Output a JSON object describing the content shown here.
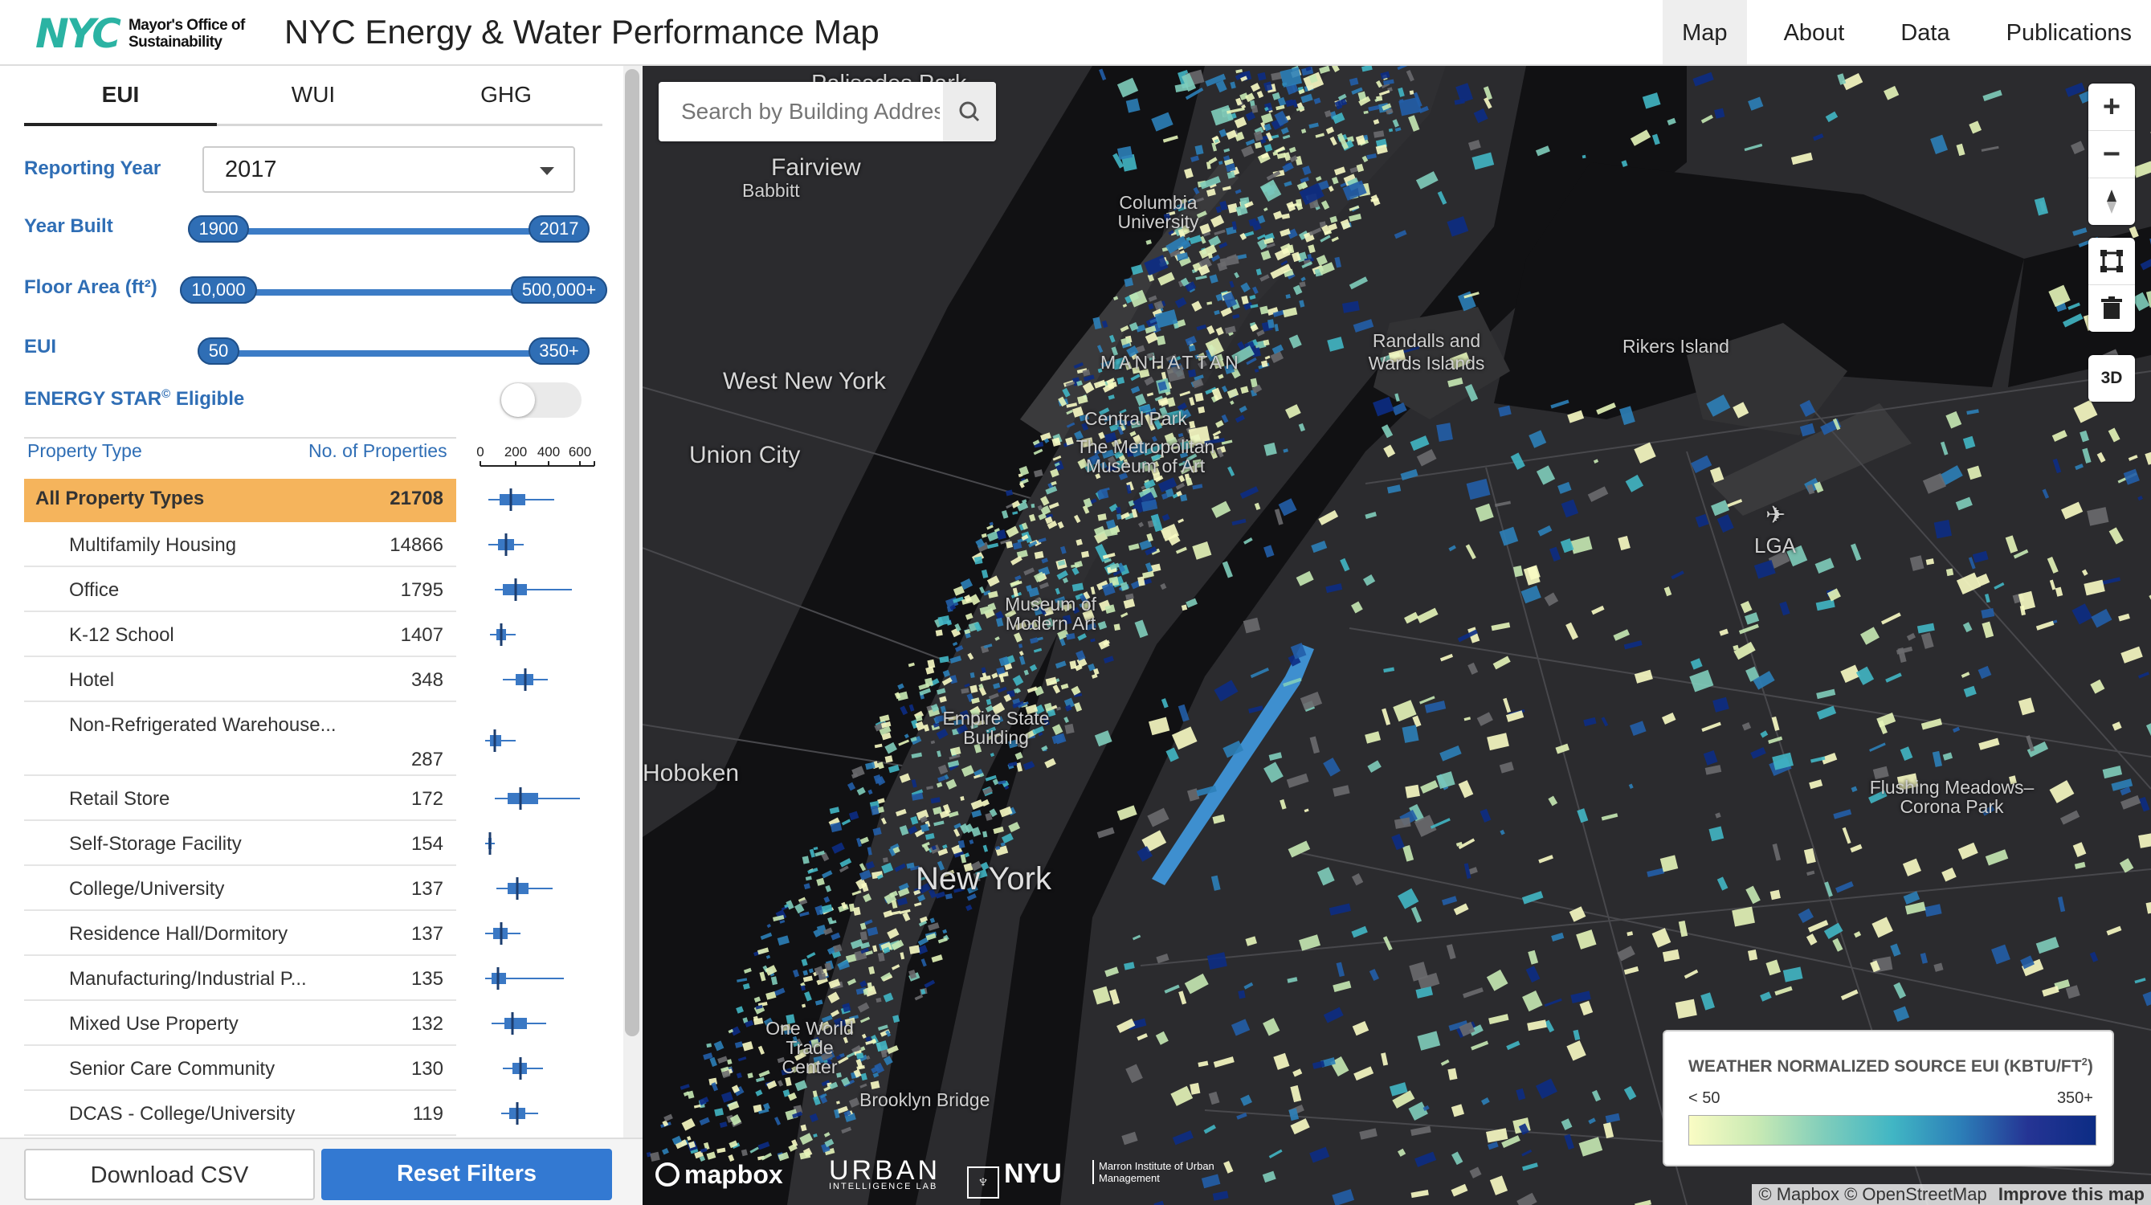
{
  "header": {
    "logo_nyc": "NYC",
    "logo_office_line1": "Mayor's Office of",
    "logo_office_line2": "Sustainability",
    "title": "NYC Energy & Water Performance Map",
    "nav": [
      {
        "label": "Map",
        "active": true
      },
      {
        "label": "About",
        "active": false
      },
      {
        "label": "Data",
        "active": false
      },
      {
        "label": "Publications",
        "active": false
      }
    ]
  },
  "sidebar": {
    "tabs": [
      {
        "label": "EUI",
        "active": true
      },
      {
        "label": "WUI",
        "active": false
      },
      {
        "label": "GHG",
        "active": false
      }
    ],
    "filters": {
      "reporting_year_label": "Reporting Year",
      "reporting_year_value": "2017",
      "year_built_label": "Year Built",
      "year_built_min": "1900",
      "year_built_max": "2017",
      "floor_area_label": "Floor Area (ft²)",
      "floor_area_min": "10,000",
      "floor_area_max": "500,000+",
      "eui_label": "EUI",
      "eui_min": "50",
      "eui_max": "350+",
      "energy_star_label": "ENERGY STAR",
      "energy_star_sup": "©",
      "energy_star_suffix": " Eligible",
      "energy_star_on": false
    },
    "list": {
      "col_type": "Property Type",
      "col_count": "No. of Properties",
      "axis_ticks": [
        "0",
        "200",
        "400",
        "600"
      ],
      "rows": [
        {
          "name": "All Property Types",
          "count": "21708",
          "selected": true,
          "box": [
            10,
            24,
            38,
            56,
            92
          ]
        },
        {
          "name": "Multifamily Housing",
          "count": "14866",
          "selected": false,
          "box": [
            10,
            22,
            32,
            42,
            54
          ]
        },
        {
          "name": "Office",
          "count": "1795",
          "selected": false,
          "box": [
            18,
            28,
            44,
            58,
            114
          ]
        },
        {
          "name": "K-12 School",
          "count": "1407",
          "selected": false,
          "box": [
            12,
            20,
            26,
            32,
            44
          ]
        },
        {
          "name": "Hotel",
          "count": "348",
          "selected": false,
          "box": [
            28,
            44,
            56,
            66,
            84
          ]
        },
        {
          "name": "Non-Refrigerated Warehouse...",
          "count": "287",
          "selected": false,
          "box": [
            6,
            12,
            18,
            26,
            44
          ]
        },
        {
          "name": "Retail Store",
          "count": "172",
          "selected": false,
          "box": [
            18,
            34,
            50,
            72,
            124
          ]
        },
        {
          "name": "Self-Storage Facility",
          "count": "154",
          "selected": false,
          "box": [
            6,
            10,
            12,
            14,
            18
          ]
        },
        {
          "name": "College/University",
          "count": "137",
          "selected": false,
          "box": [
            20,
            34,
            46,
            60,
            90
          ]
        },
        {
          "name": "Residence Hall/Dormitory",
          "count": "137",
          "selected": false,
          "box": [
            6,
            16,
            26,
            34,
            50
          ]
        },
        {
          "name": "Manufacturing/Industrial P...",
          "count": "135",
          "selected": false,
          "box": [
            6,
            14,
            22,
            32,
            104
          ]
        },
        {
          "name": "Mixed Use Property",
          "count": "132",
          "selected": false,
          "box": [
            14,
            30,
            40,
            58,
            82
          ]
        },
        {
          "name": "Senior Care Community",
          "count": "130",
          "selected": false,
          "box": [
            28,
            40,
            50,
            58,
            78
          ]
        },
        {
          "name": "DCAS - College/University",
          "count": "119",
          "selected": false,
          "box": [
            26,
            36,
            46,
            56,
            72
          ]
        }
      ]
    },
    "buttons": {
      "download": "Download CSV",
      "reset": "Reset Filters"
    }
  },
  "map": {
    "search_placeholder": "Search by Building Address",
    "labels": [
      "Palisades Park",
      "Fairview",
      "Babbitt",
      "Columbia University",
      "MANHATTAN",
      "Randalls and Wards Islands",
      "Rikers Island",
      "West New York",
      "Union City",
      "Central Park",
      "The Metropolitan Museum of Art",
      "LGA",
      "Museum of Modern Art",
      "Empire State Building",
      "Hoboken",
      "Flushing Meadows–Corona Park",
      "New York",
      "One World Trade Center",
      "Brooklyn Bridge"
    ],
    "controls": {
      "zoom_in": "+",
      "zoom_out": "−",
      "three_d": "3D"
    },
    "legend": {
      "title": "WEATHER NORMALIZED SOURCE EUI (KBTU/FT",
      "title_sup": "2",
      "title_end": ")",
      "min": "< 50",
      "max": "350+"
    },
    "branding": {
      "mapbox": "mapbox",
      "urban": "URBAN",
      "urban_sub": "INTELLIGENCE LAB",
      "nyu": "NYU",
      "marron": "Marron Institute of Urban Management"
    },
    "attribution": {
      "text": "© Mapbox © OpenStreetMap",
      "improve": "Improve this map"
    },
    "colors": {
      "low": "#fafcc4",
      "high": "#0c2c84",
      "mid": "#41b6c4"
    }
  }
}
